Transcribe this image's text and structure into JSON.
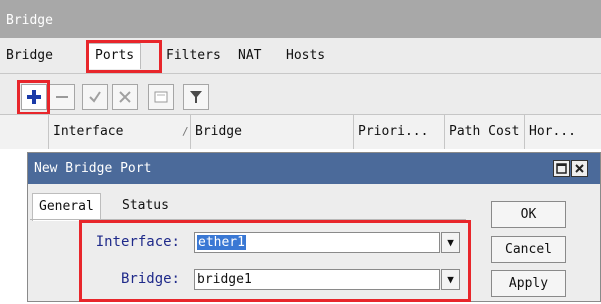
{
  "window": {
    "title": "Bridge"
  },
  "tabs": [
    "Bridge",
    "Ports",
    "Filters",
    "NAT",
    "Hosts"
  ],
  "toolbar": {
    "add": "+",
    "remove": "−",
    "enable": "✓",
    "disable": "✕",
    "comment": "▭",
    "filter": "▼"
  },
  "table": {
    "columns": [
      "Interface",
      "/",
      "Bridge",
      "Priori...",
      "Path Cost",
      "Hor..."
    ]
  },
  "dialog": {
    "title": "New Bridge Port",
    "tabs": [
      "General",
      "Status"
    ],
    "fields": {
      "interface_label": "Interface:",
      "interface_value": "ether1",
      "bridge_label": "Bridge:",
      "bridge_value": "bridge1"
    },
    "buttons": {
      "ok": "OK",
      "cancel": "Cancel",
      "apply": "Apply"
    },
    "dropdown_glyph": "▼"
  },
  "colors": {
    "highlight": "#e8262b",
    "title_bar": "#4b6a9a",
    "selection": "#3a78d4"
  }
}
